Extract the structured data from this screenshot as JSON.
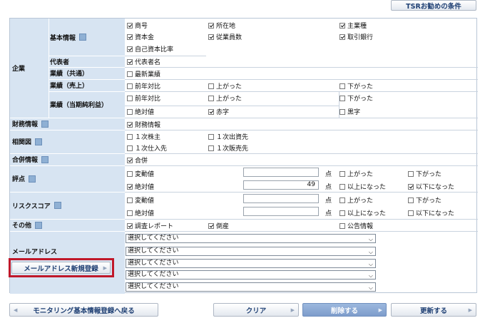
{
  "top_button": "TSRお勧めの条件",
  "sections": {
    "company": "企業",
    "basic_info": "基本情報",
    "representative": "代表者",
    "results_all": "業績（共通）",
    "results_sales": "業績（売上）",
    "results_profit": "業績（当期純利益）",
    "financial": "財務情報",
    "relationship": "相関図",
    "merger": "合併情報",
    "score": "評点",
    "risk_score": "リスクスコア",
    "other": "その他",
    "mail": "メールアドレス"
  },
  "checkboxes": {
    "trade_name": {
      "label": "商号",
      "checked": true
    },
    "location": {
      "label": "所在地",
      "checked": true
    },
    "main_industry": {
      "label": "主業種",
      "checked": true
    },
    "capital": {
      "label": "資本金",
      "checked": true
    },
    "employees": {
      "label": "従業員数",
      "checked": true
    },
    "bank": {
      "label": "取引銀行",
      "checked": true
    },
    "equity_ratio": {
      "label": "自己資本比率",
      "checked": true
    },
    "rep_name": {
      "label": "代表者名",
      "checked": true
    },
    "latest_results": {
      "label": "最新業績",
      "checked": false
    },
    "sales_yoy": {
      "label": "前年対比",
      "checked": false
    },
    "sales_up": {
      "label": "上がった",
      "checked": false
    },
    "sales_down": {
      "label": "下がった",
      "checked": false
    },
    "profit_yoy": {
      "label": "前年対比",
      "checked": false
    },
    "profit_up": {
      "label": "上がった",
      "checked": false
    },
    "profit_down": {
      "label": "下がった",
      "checked": false
    },
    "profit_abs": {
      "label": "絶対値",
      "checked": false
    },
    "profit_red": {
      "label": "赤字",
      "checked": true
    },
    "profit_black": {
      "label": "黒字",
      "checked": false
    },
    "financial_info": {
      "label": "財務情報",
      "checked": true
    },
    "primary_shareholder": {
      "label": "１次株主",
      "checked": false
    },
    "primary_investee": {
      "label": "１次出資先",
      "checked": false
    },
    "primary_supplier": {
      "label": "１次仕入先",
      "checked": false
    },
    "primary_customer": {
      "label": "１次販売先",
      "checked": false
    },
    "merger": {
      "label": "合併",
      "checked": true
    },
    "score_change": {
      "label": "変動値",
      "checked": false
    },
    "score_up": {
      "label": "上がった",
      "checked": false
    },
    "score_down": {
      "label": "下がった",
      "checked": false
    },
    "score_abs": {
      "label": "絶対値",
      "checked": true
    },
    "score_above": {
      "label": "以上になった",
      "checked": false
    },
    "score_below": {
      "label": "以下になった",
      "checked": true
    },
    "risk_change": {
      "label": "変動値",
      "checked": false
    },
    "risk_up": {
      "label": "上がった",
      "checked": false
    },
    "risk_down": {
      "label": "下がった",
      "checked": false
    },
    "risk_abs": {
      "label": "絶対値",
      "checked": false
    },
    "risk_above": {
      "label": "以上になった",
      "checked": false
    },
    "risk_below": {
      "label": "以下になった",
      "checked": false
    },
    "report": {
      "label": "調査レポート",
      "checked": true
    },
    "bankruptcy": {
      "label": "倒産",
      "checked": true
    },
    "bulletin": {
      "label": "公告情報",
      "checked": false
    }
  },
  "inputs": {
    "score_change_value": "",
    "score_abs_value": "49",
    "risk_change_value": "",
    "risk_abs_value": ""
  },
  "point_unit": "点",
  "mail_selects": [
    "選択してください",
    "選択してください",
    "選択してください",
    "選択してください",
    "選択してください"
  ],
  "mail_register_button": "メールアドレス新規登録",
  "highlight_color": "#c0182a",
  "bottom_buttons": {
    "back": "モニタリング基本情報登録へ戻る",
    "clear": "クリア",
    "delete": "削除する",
    "update": "更新する"
  }
}
